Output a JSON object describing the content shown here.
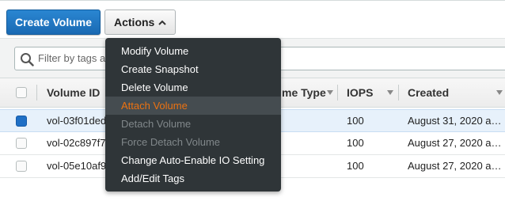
{
  "toolbar": {
    "create_label": "Create Volume",
    "actions_label": "Actions"
  },
  "filter": {
    "placeholder": "Filter by tags a"
  },
  "table": {
    "columns": [
      "Volume ID",
      "me Type",
      "IOPS",
      "Created"
    ],
    "rows": [
      {
        "volume_id": "vol-03f01ded",
        "iops": "100",
        "created": "August 31, 2020 a…",
        "selected": true
      },
      {
        "volume_id": "vol-02c897f7",
        "iops": "100",
        "created": "August 27, 2020 a…",
        "selected": false
      },
      {
        "volume_id": "vol-05e10af9",
        "iops": "100",
        "created": "August 27, 2020 a…",
        "selected": false
      }
    ]
  },
  "actions_menu": {
    "items": [
      {
        "label": "Modify Volume",
        "state": "normal"
      },
      {
        "label": "Create Snapshot",
        "state": "normal"
      },
      {
        "label": "Delete Volume",
        "state": "normal"
      },
      {
        "label": "Attach Volume",
        "state": "hover"
      },
      {
        "label": "Detach Volume",
        "state": "disabled"
      },
      {
        "label": "Force Detach Volume",
        "state": "disabled"
      },
      {
        "label": "Change Auto-Enable IO Setting",
        "state": "normal"
      },
      {
        "label": "Add/Edit Tags",
        "state": "normal"
      }
    ]
  },
  "colors": {
    "primary_button": "#1a6ab3",
    "menu_background": "#2f3538",
    "menu_hover_text": "#ec7211",
    "selected_checkbox": "#1f6fc5"
  }
}
